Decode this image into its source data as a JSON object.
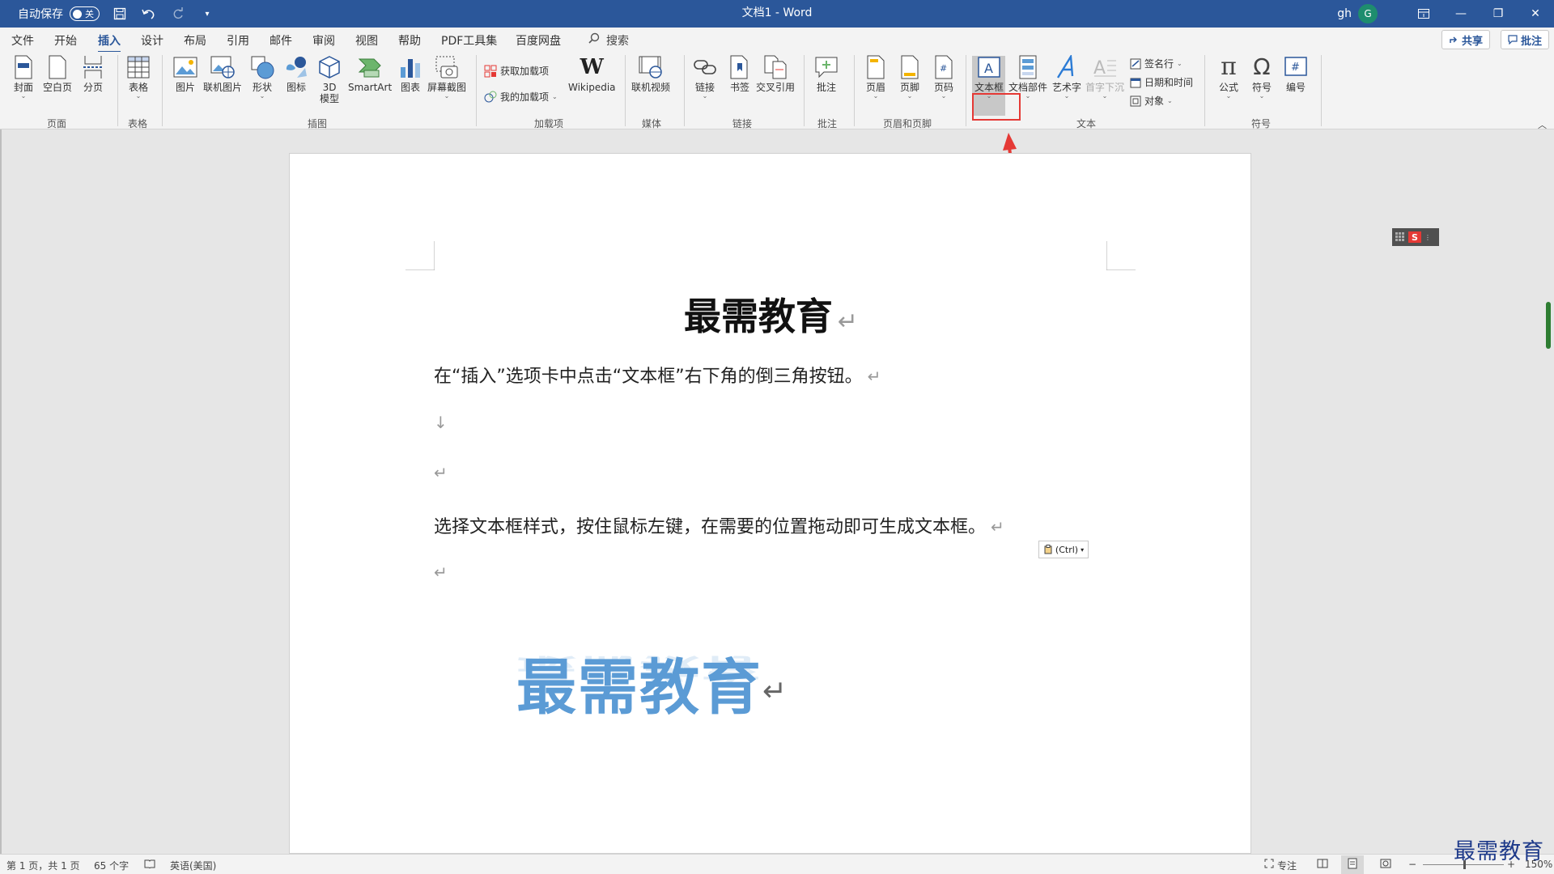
{
  "titlebar": {
    "autosave_label": "自动保存",
    "autosave_state": "关",
    "doc_title": "文档1 - Word",
    "user": "gh",
    "avatar_letter": "G",
    "bg_color": "#2b579a"
  },
  "tabs": [
    "文件",
    "开始",
    "插入",
    "设计",
    "布局",
    "引用",
    "邮件",
    "审阅",
    "视图",
    "帮助",
    "PDF工具集",
    "百度网盘"
  ],
  "active_tab": "插入",
  "search_label": "搜索",
  "share_label": "共享",
  "comments_label": "批注",
  "ribbon": {
    "pages": {
      "cover": "封面",
      "blank": "空白页",
      "break": "分页",
      "group": "页面"
    },
    "tables": {
      "table": "表格",
      "group": "表格"
    },
    "illustrations": {
      "picture": "图片",
      "online_picture": "联机图片",
      "shapes": "形状",
      "icons": "图标",
      "model3d_1": "3D",
      "model3d_2": "模型",
      "smartart": "SmartArt",
      "chart": "图表",
      "screenshot": "屏幕截图",
      "group": "插图"
    },
    "addins": {
      "get": "获取加载项",
      "my": "我的加载项",
      "wikipedia": "Wikipedia",
      "group": "加载项"
    },
    "media": {
      "online_video": "联机视频",
      "group": "媒体"
    },
    "links": {
      "link": "链接",
      "bookmark": "书签",
      "cross_ref": "交叉引用",
      "group": "链接"
    },
    "comments": {
      "comment": "批注",
      "group": "批注"
    },
    "header_footer": {
      "header": "页眉",
      "footer": "页脚",
      "page_number": "页码",
      "group": "页眉和页脚"
    },
    "text": {
      "textbox": "文本框",
      "quick_parts": "文档部件",
      "wordart": "艺术字",
      "dropcap": "首字下沉",
      "signature": "签名行",
      "datetime": "日期和时间",
      "object": "对象",
      "group": "文本"
    },
    "symbols": {
      "equation": "公式",
      "symbol": "符号",
      "numbering": "编号",
      "group": "符号"
    }
  },
  "document": {
    "title": "最需教育",
    "para1": "在“插入”选项卡中点击“文本框”右下角的倒三角按钮。",
    "para2": "选择文本框样式，按住鼠标左键，在需要的位置拖动即可生成文本框。",
    "paste_label": "(Ctrl)",
    "wordart_text": "最需教育",
    "para_mark": "↵",
    "line_break_mark": "↓"
  },
  "statusbar": {
    "page": "第 1 页，共 1 页",
    "words": "65 个字",
    "language": "英语(美国)",
    "focus": "专注",
    "zoom": "150%"
  },
  "watermark": "最需教育",
  "colors": {
    "accent": "#2b579a",
    "highlight_red": "#e53935",
    "wordart_blue": "#5b9bd5"
  }
}
